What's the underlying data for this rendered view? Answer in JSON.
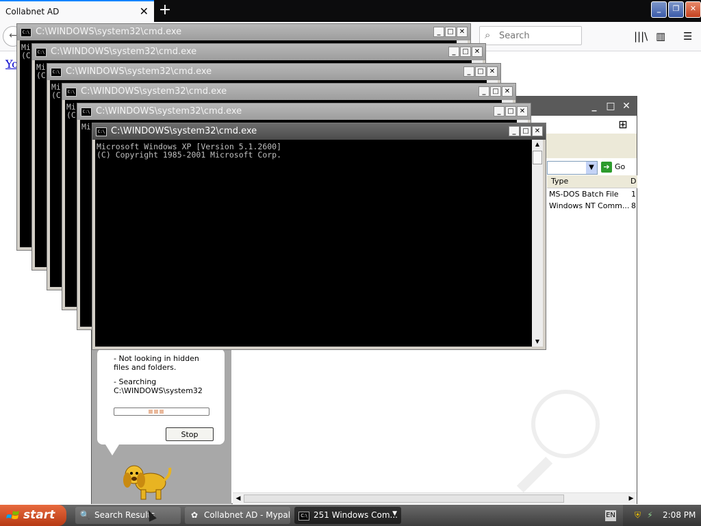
{
  "browser": {
    "tab_title": "Collabnet AD",
    "tab_close_icon": "close-icon",
    "new_tab_icon": "plus-icon",
    "search_placeholder": "Search",
    "page_link_text": "Yo"
  },
  "explorer": {
    "go_label": "Go",
    "column_type": "Type",
    "column_d": "D",
    "rows": [
      {
        "type": "MS-DOS Batch File",
        "d": "1"
      },
      {
        "type": "Windows NT Comm...",
        "d": "8"
      }
    ],
    "companion": {
      "line1": "- Not looking in hidden files and folders.",
      "line2": "- Searching C:\\WINDOWS\\system32",
      "stop_label": "Stop"
    }
  },
  "cmd": {
    "title": "C:\\WINDOWS\\system32\\cmd.exe",
    "console_line1": "Microsoft Windows XP [Version 5.1.2600]",
    "console_line2": "(C) Copyright 1985-2001 Microsoft Corp.",
    "fragment_mi": "Mi",
    "fragment_c": "(C",
    "minimize": "_",
    "maximize": "□",
    "close": "✕"
  },
  "taskbar": {
    "start_label": "start",
    "tasks": [
      {
        "label": "Search Results",
        "icon": "search-results-icon"
      },
      {
        "label": "Collabnet AD - Mypal",
        "icon": "mypal-icon"
      },
      {
        "label": "251 Windows Com...",
        "icon": "cmd-icon"
      }
    ],
    "clock": "2:08 PM"
  }
}
